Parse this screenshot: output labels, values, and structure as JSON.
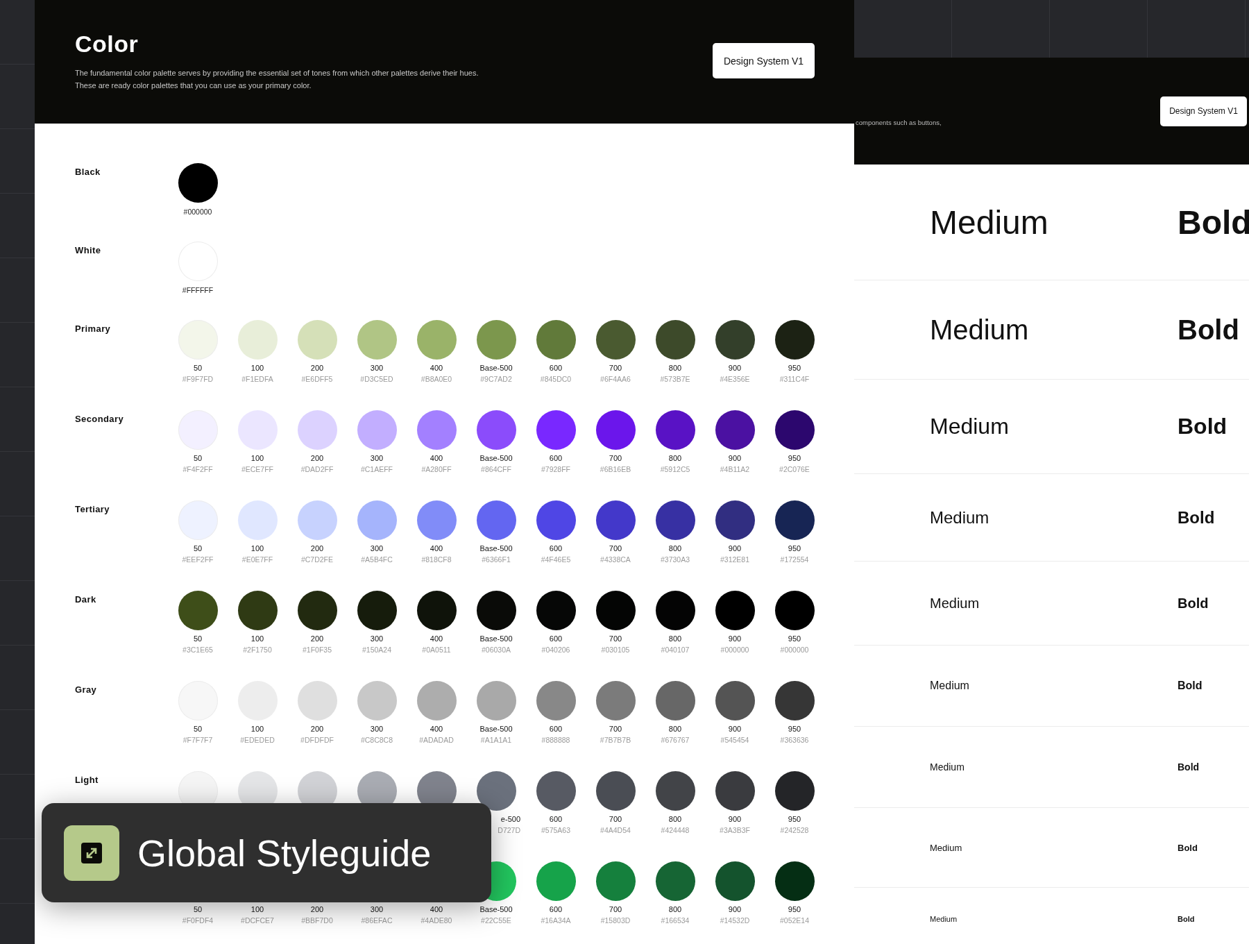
{
  "color_page": {
    "title": "Color",
    "description": [
      "The fundamental color palette serves by providing the essential set of tones from which other palettes derive their hues.",
      "These are ready color palettes that you can use as your primary color."
    ],
    "button": "Design System V1"
  },
  "palettes": [
    {
      "name": "Black",
      "swatches": [
        {
          "color": "#000000",
          "hex": "#000000"
        }
      ]
    },
    {
      "name": "White",
      "swatches": [
        {
          "color": "#ffffff",
          "hex": "#FFFFFF"
        }
      ]
    },
    {
      "name": "Primary",
      "swatches": [
        {
          "color": "#f3f6ea",
          "step": "50",
          "hex": "#F9F7FD"
        },
        {
          "color": "#e8eed9",
          "step": "100",
          "hex": "#F1EDFA"
        },
        {
          "color": "#d5e0b8",
          "step": "200",
          "hex": "#E6DFF5"
        },
        {
          "color": "#b0c585",
          "step": "300",
          "hex": "#D3C5ED"
        },
        {
          "color": "#9ab369",
          "step": "400",
          "hex": "#B8A0E0"
        },
        {
          "color": "#7c974d",
          "step": "Base-500",
          "hex": "#9C7AD2"
        },
        {
          "color": "#617a3a",
          "step": "600",
          "hex": "#845DC0"
        },
        {
          "color": "#4a5a30",
          "step": "700",
          "hex": "#6F4AA6"
        },
        {
          "color": "#3d4a2a",
          "step": "800",
          "hex": "#573B7E"
        },
        {
          "color": "#333f2a",
          "step": "900",
          "hex": "#4E356E"
        },
        {
          "color": "#1c2214",
          "step": "950",
          "hex": "#311C4F"
        }
      ]
    },
    {
      "name": "Secondary",
      "swatches": [
        {
          "color": "#f3f0ff",
          "step": "50",
          "hex": "#F4F2FF"
        },
        {
          "color": "#ebe6ff",
          "step": "100",
          "hex": "#ECE7FF"
        },
        {
          "color": "#dcd2ff",
          "step": "200",
          "hex": "#DAD2FF"
        },
        {
          "color": "#c2aeff",
          "step": "300",
          "hex": "#C1AEFF"
        },
        {
          "color": "#a380ff",
          "step": "400",
          "hex": "#A280FF"
        },
        {
          "color": "#8b4cfb",
          "step": "Base-500",
          "hex": "#864CFF"
        },
        {
          "color": "#7928ff",
          "step": "600",
          "hex": "#7928FF"
        },
        {
          "color": "#6b16eb",
          "step": "700",
          "hex": "#6B16EB"
        },
        {
          "color": "#5912c5",
          "step": "800",
          "hex": "#5912C5"
        },
        {
          "color": "#4b11a2",
          "step": "900",
          "hex": "#4B11A2"
        },
        {
          "color": "#2c076e",
          "step": "950",
          "hex": "#2C076E"
        }
      ]
    },
    {
      "name": "Tertiary",
      "swatches": [
        {
          "color": "#eef2ff",
          "step": "50",
          "hex": "#EEF2FF"
        },
        {
          "color": "#e0e7ff",
          "step": "100",
          "hex": "#E0E7FF"
        },
        {
          "color": "#c7d2fe",
          "step": "200",
          "hex": "#C7D2FE"
        },
        {
          "color": "#a5b4fc",
          "step": "300",
          "hex": "#A5B4FC"
        },
        {
          "color": "#818cf8",
          "step": "400",
          "hex": "#818CF8"
        },
        {
          "color": "#6366f1",
          "step": "Base-500",
          "hex": "#6366F1"
        },
        {
          "color": "#4f46e5",
          "step": "600",
          "hex": "#4F46E5"
        },
        {
          "color": "#4338ca",
          "step": "700",
          "hex": "#4338CA"
        },
        {
          "color": "#3730a3",
          "step": "800",
          "hex": "#3730A3"
        },
        {
          "color": "#312e81",
          "step": "900",
          "hex": "#312E81"
        },
        {
          "color": "#172554",
          "step": "950",
          "hex": "#172554"
        }
      ]
    },
    {
      "name": "Dark",
      "swatches": [
        {
          "color": "#3e4e19",
          "step": "50",
          "hex": "#3C1E65"
        },
        {
          "color": "#2f3a14",
          "step": "100",
          "hex": "#2F1750"
        },
        {
          "color": "#222a10",
          "step": "200",
          "hex": "#1F0F35"
        },
        {
          "color": "#161c0c",
          "step": "300",
          "hex": "#150A24"
        },
        {
          "color": "#0f130a",
          "step": "400",
          "hex": "#0A0511"
        },
        {
          "color": "#0a0b08",
          "step": "Base-500",
          "hex": "#06030A"
        },
        {
          "color": "#060706",
          "step": "600",
          "hex": "#040206"
        },
        {
          "color": "#040504",
          "step": "700",
          "hex": "#030105"
        },
        {
          "color": "#040404",
          "step": "800",
          "hex": "#040107"
        },
        {
          "color": "#000000",
          "step": "900",
          "hex": "#000000"
        },
        {
          "color": "#000000",
          "step": "950",
          "hex": "#000000"
        }
      ]
    },
    {
      "name": "Gray",
      "swatches": [
        {
          "color": "#f7f7f7",
          "step": "50",
          "hex": "#F7F7F7"
        },
        {
          "color": "#ededed",
          "step": "100",
          "hex": "#EDEDED"
        },
        {
          "color": "#dfdfdf",
          "step": "200",
          "hex": "#DFDFDF"
        },
        {
          "color": "#c8c8c8",
          "step": "300",
          "hex": "#C8C8C8"
        },
        {
          "color": "#adadad",
          "step": "400",
          "hex": "#ADADAD"
        },
        {
          "color": "#a9a9a9",
          "step": "Base-500",
          "hex": "#A1A1A1"
        },
        {
          "color": "#888888",
          "step": "600",
          "hex": "#888888"
        },
        {
          "color": "#7b7b7b",
          "step": "700",
          "hex": "#7B7B7B"
        },
        {
          "color": "#676767",
          "step": "800",
          "hex": "#676767"
        },
        {
          "color": "#545454",
          "step": "900",
          "hex": "#545454"
        },
        {
          "color": "#363636",
          "step": "950",
          "hex": "#363636"
        }
      ]
    },
    {
      "name": "Light",
      "swatches": [
        {
          "color": "#f5f5f5"
        },
        {
          "color": "#e4e5e7"
        },
        {
          "color": "#d1d2d6"
        },
        {
          "color": "#a9acb3"
        },
        {
          "color": "#80838d"
        },
        {
          "color": "#6b717d",
          "step": "e-500",
          "hex": "D727D",
          "partial": true
        },
        {
          "color": "#575a63",
          "step": "600",
          "hex": "#575A63"
        },
        {
          "color": "#4a4d54",
          "step": "700",
          "hex": "#4A4D54"
        },
        {
          "color": "#424448",
          "step": "800",
          "hex": "#424448"
        },
        {
          "color": "#3a3b3f",
          "step": "900",
          "hex": "#3A3B3F"
        },
        {
          "color": "#242528",
          "step": "950",
          "hex": "#242528"
        }
      ]
    },
    {
      "swatches": [
        {
          "step": "50",
          "hex": "#F0FDF4"
        },
        {
          "step": "100",
          "hex": "#DCFCE7"
        },
        {
          "step": "200",
          "hex": "#BBF7D0"
        },
        {
          "step": "300",
          "hex": "#86EFAC"
        },
        {
          "step": "400",
          "hex": "#4ADE80"
        },
        {
          "color": "#22c55e",
          "step": "Base-500",
          "hex": "#22C55E"
        },
        {
          "color": "#16a34a",
          "step": "600",
          "hex": "#16A34A"
        },
        {
          "color": "#15803d",
          "step": "700",
          "hex": "#15803D"
        },
        {
          "color": "#166534",
          "step": "800",
          "hex": "#166534"
        },
        {
          "color": "#14532d",
          "step": "900",
          "hex": "#14532D"
        },
        {
          "color": "#052e14",
          "step": "950",
          "hex": "#052E14"
        }
      ]
    }
  ],
  "overlay": {
    "title": "Global Styleguide"
  },
  "type_page": {
    "header_text": "components such as buttons,",
    "button": "Design System V1",
    "rows": [
      {
        "medium": "Medium",
        "bold": "Bold"
      },
      {
        "medium": "Medium",
        "bold": "Bold"
      },
      {
        "medium": "Medium",
        "bold": "Bold"
      },
      {
        "medium": "Medium",
        "bold": "Bold"
      },
      {
        "medium": "Medium",
        "bold": "Bold"
      },
      {
        "medium": "Medium",
        "bold": "Bold"
      },
      {
        "medium": "Medium",
        "bold": "Bold"
      },
      {
        "medium": "Medium",
        "bold": "Bold"
      },
      {
        "medium": "Medium",
        "bold": "Bold"
      }
    ]
  }
}
